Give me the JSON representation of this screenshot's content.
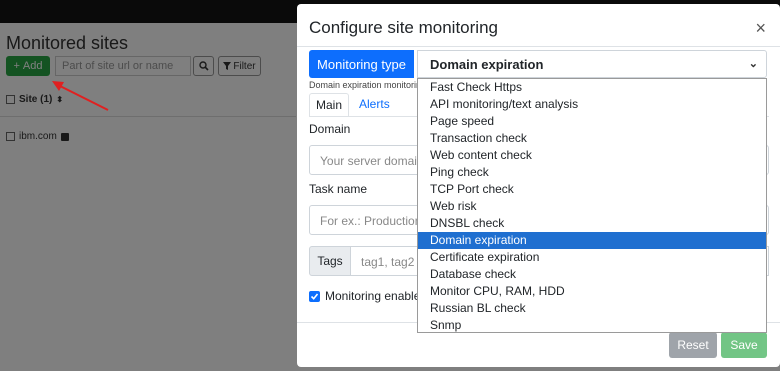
{
  "background": {
    "title": "Monitored sites",
    "add_label": "Add",
    "search_placeholder": "Part of site url or name",
    "filter_label": "Filter",
    "column_header": "Site (1)",
    "rows": [
      "ibm.com"
    ]
  },
  "modal": {
    "title": "Configure site monitoring",
    "close": "×",
    "monitoring_type_label": "Monitoring type",
    "monitoring_type_value": "Domain expiration",
    "subtitle": "Domain expiration monitoring",
    "tabs": [
      "Main",
      "Alerts"
    ],
    "domain_label": "Domain",
    "domain_placeholder": "Your server domain",
    "task_label": "Task name",
    "task_placeholder": "For ex.: Production",
    "tags_label": "Tags",
    "tags_placeholder": "tag1, tag2",
    "monitoring_enabled_label": "Monitoring enabled",
    "reset_label": "Reset",
    "save_label": "Save"
  },
  "dropdown": {
    "selected_index": 9,
    "options": [
      "Fast Check Https",
      "API monitoring/text analysis",
      "Page speed",
      "Transaction check",
      "Web content check",
      "Ping check",
      "TCP Port check",
      "Web risk",
      "DNSBL check",
      "Domain expiration",
      "Certificate expiration",
      "Database check",
      "Monitor CPU, RAM, HDD",
      "Russian BL check",
      "Snmp"
    ]
  },
  "colors": {
    "primary": "#0d6efd",
    "success": "#28a745",
    "selected": "#1f6fd0",
    "annotation_arrow": "#e02020"
  }
}
